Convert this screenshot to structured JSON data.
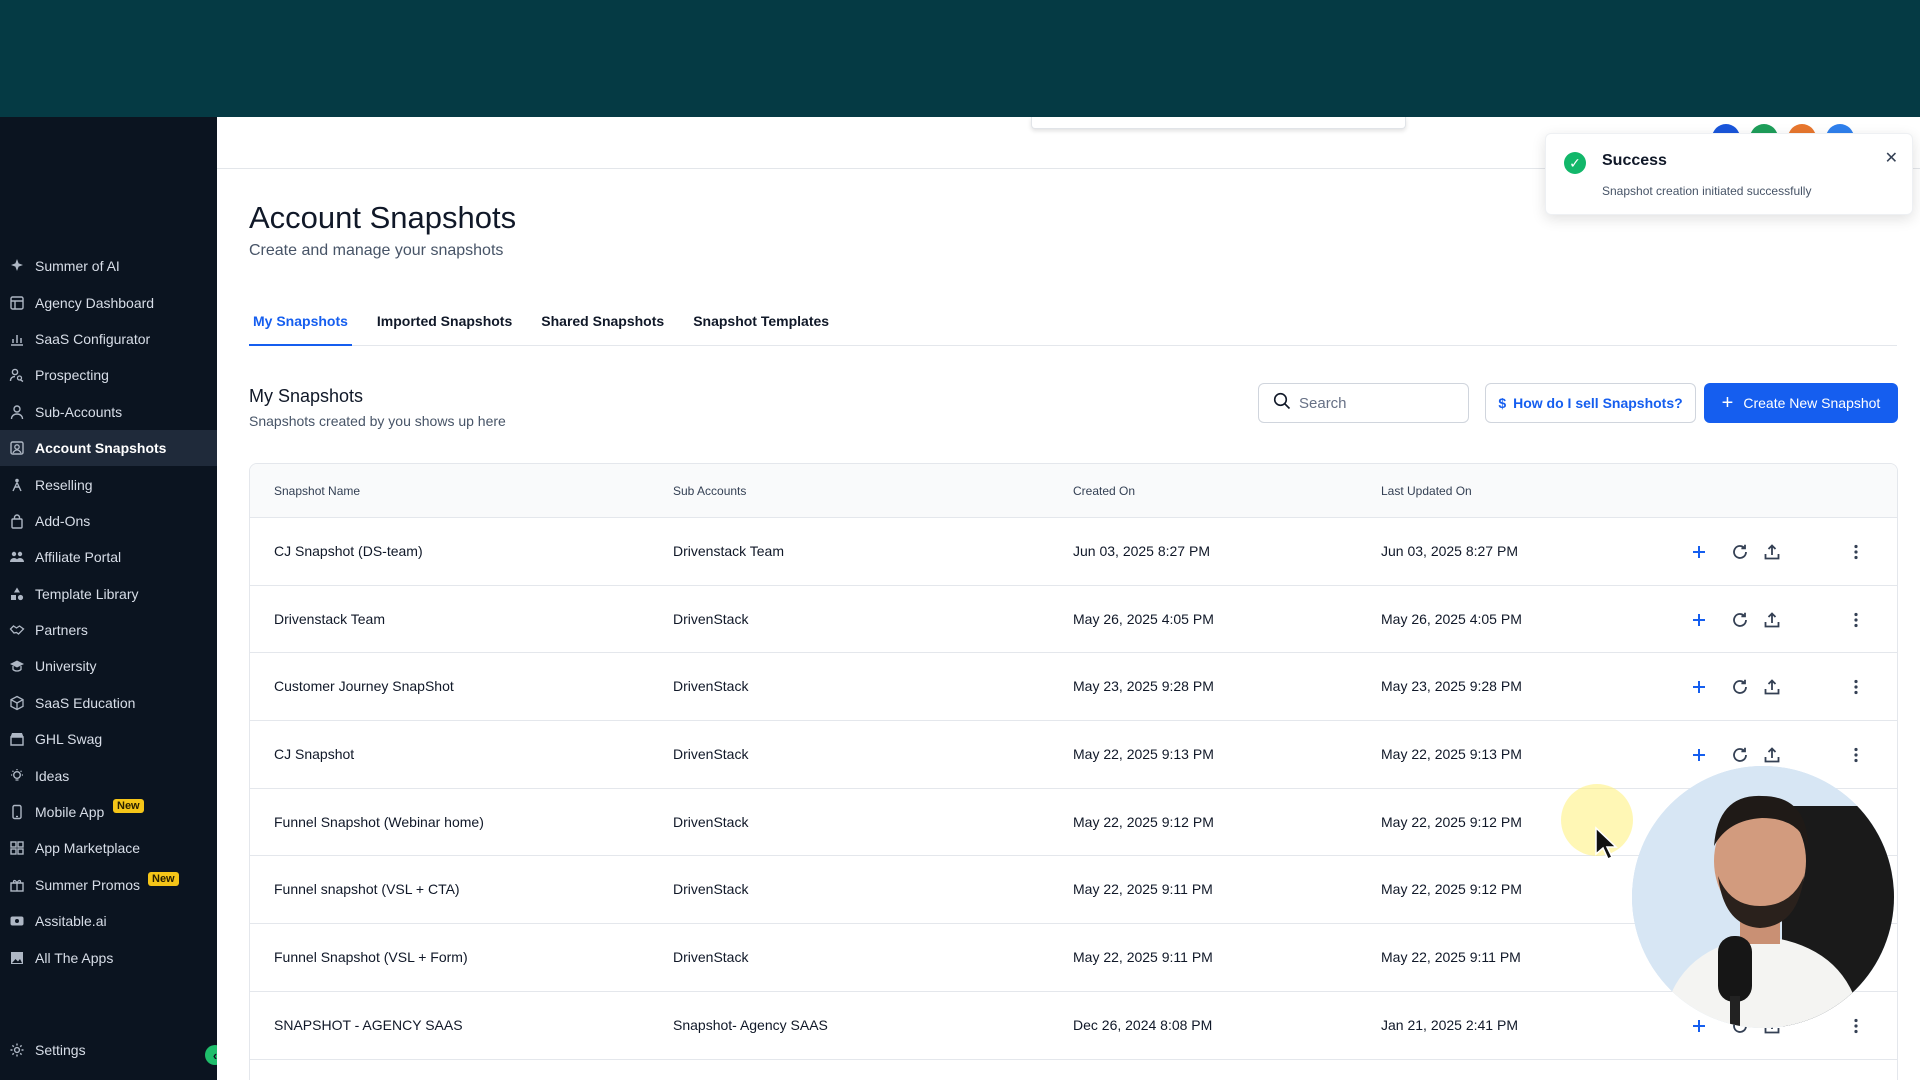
{
  "sidebar": {
    "items": [
      {
        "label": "Summer of AI",
        "icon": "sparkle-icon"
      },
      {
        "label": "Agency Dashboard",
        "icon": "dashboard-icon"
      },
      {
        "label": "SaaS Configurator",
        "icon": "chart-icon"
      },
      {
        "label": "Prospecting",
        "icon": "person-search-icon"
      },
      {
        "label": "Sub-Accounts",
        "icon": "user-icon"
      },
      {
        "label": "Account Snapshots",
        "icon": "snapshot-icon",
        "active": true
      },
      {
        "label": "Reselling",
        "icon": "reselling-icon"
      },
      {
        "label": "Add-Ons",
        "icon": "bag-icon"
      },
      {
        "label": "Affiliate Portal",
        "icon": "group-icon"
      },
      {
        "label": "Template Library",
        "icon": "shapes-icon"
      },
      {
        "label": "Partners",
        "icon": "handshake-icon"
      },
      {
        "label": "University",
        "icon": "graduation-cap-icon"
      },
      {
        "label": "SaaS Education",
        "icon": "box-icon"
      },
      {
        "label": "GHL Swag",
        "icon": "store-icon"
      },
      {
        "label": "Ideas",
        "icon": "lightbulb-icon"
      },
      {
        "label": "Mobile App",
        "icon": "mobile-icon",
        "badge": "New"
      },
      {
        "label": "App Marketplace",
        "icon": "grid-icon"
      },
      {
        "label": "Summer Promos",
        "icon": "gift-icon",
        "badge": "New"
      },
      {
        "label": "Assitable.ai",
        "icon": "video-icon"
      },
      {
        "label": "All The Apps",
        "icon": "image-icon"
      }
    ],
    "settings_label": "Settings"
  },
  "header": {
    "title": "Account Snapshots",
    "subtitle": "Create and manage your snapshots"
  },
  "tabs": [
    {
      "label": "My Snapshots",
      "active": true
    },
    {
      "label": "Imported Snapshots"
    },
    {
      "label": "Shared Snapshots"
    },
    {
      "label": "Snapshot Templates"
    }
  ],
  "section": {
    "title": "My Snapshots",
    "subtitle": "Snapshots created by you shows up here"
  },
  "toolbar": {
    "search_placeholder": "Search",
    "sell_label": "How do I sell Snapshots?",
    "create_label": "Create New Snapshot"
  },
  "table": {
    "columns": [
      "Snapshot Name",
      "Sub Accounts",
      "Created On",
      "Last Updated On"
    ],
    "rows": [
      {
        "name": "CJ Snapshot (DS-team)",
        "sub": "Drivenstack Team",
        "created": "Jun 03, 2025 8:27 PM",
        "updated": "Jun 03, 2025 8:27 PM"
      },
      {
        "name": "Drivenstack Team",
        "sub": "DrivenStack",
        "created": "May 26, 2025 4:05 PM",
        "updated": "May 26, 2025 4:05 PM"
      },
      {
        "name": "Customer Journey SnapShot",
        "sub": "DrivenStack",
        "created": "May 23, 2025 9:28 PM",
        "updated": "May 23, 2025 9:28 PM"
      },
      {
        "name": "CJ Snapshot",
        "sub": "DrivenStack",
        "created": "May 22, 2025 9:13 PM",
        "updated": "May 22, 2025 9:13 PM"
      },
      {
        "name": "Funnel Snapshot (Webinar home)",
        "sub": "DrivenStack",
        "created": "May 22, 2025 9:12 PM",
        "updated": "May 22, 2025 9:12 PM"
      },
      {
        "name": "Funnel snapshot (VSL + CTA)",
        "sub": "DrivenStack",
        "created": "May 22, 2025 9:11 PM",
        "updated": "May 22, 2025 9:12 PM"
      },
      {
        "name": "Funnel Snapshot (VSL + Form)",
        "sub": "DrivenStack",
        "created": "May 22, 2025 9:11 PM",
        "updated": "May 22, 2025 9:11 PM"
      },
      {
        "name": "SNAPSHOT - AGENCY SAAS",
        "sub": "Snapshot- Agency SAAS",
        "created": "Dec 26, 2024 8:08 PM",
        "updated": "Jan 21, 2025 2:41 PM"
      }
    ]
  },
  "toast": {
    "title": "Success",
    "message": "Snapshot creation initiated successfully"
  },
  "colors": {
    "topband": "#053a44",
    "sidebar_bg": "#0b1420",
    "accent": "#155eef",
    "success": "#12b76a",
    "badge": "#f5c518"
  }
}
